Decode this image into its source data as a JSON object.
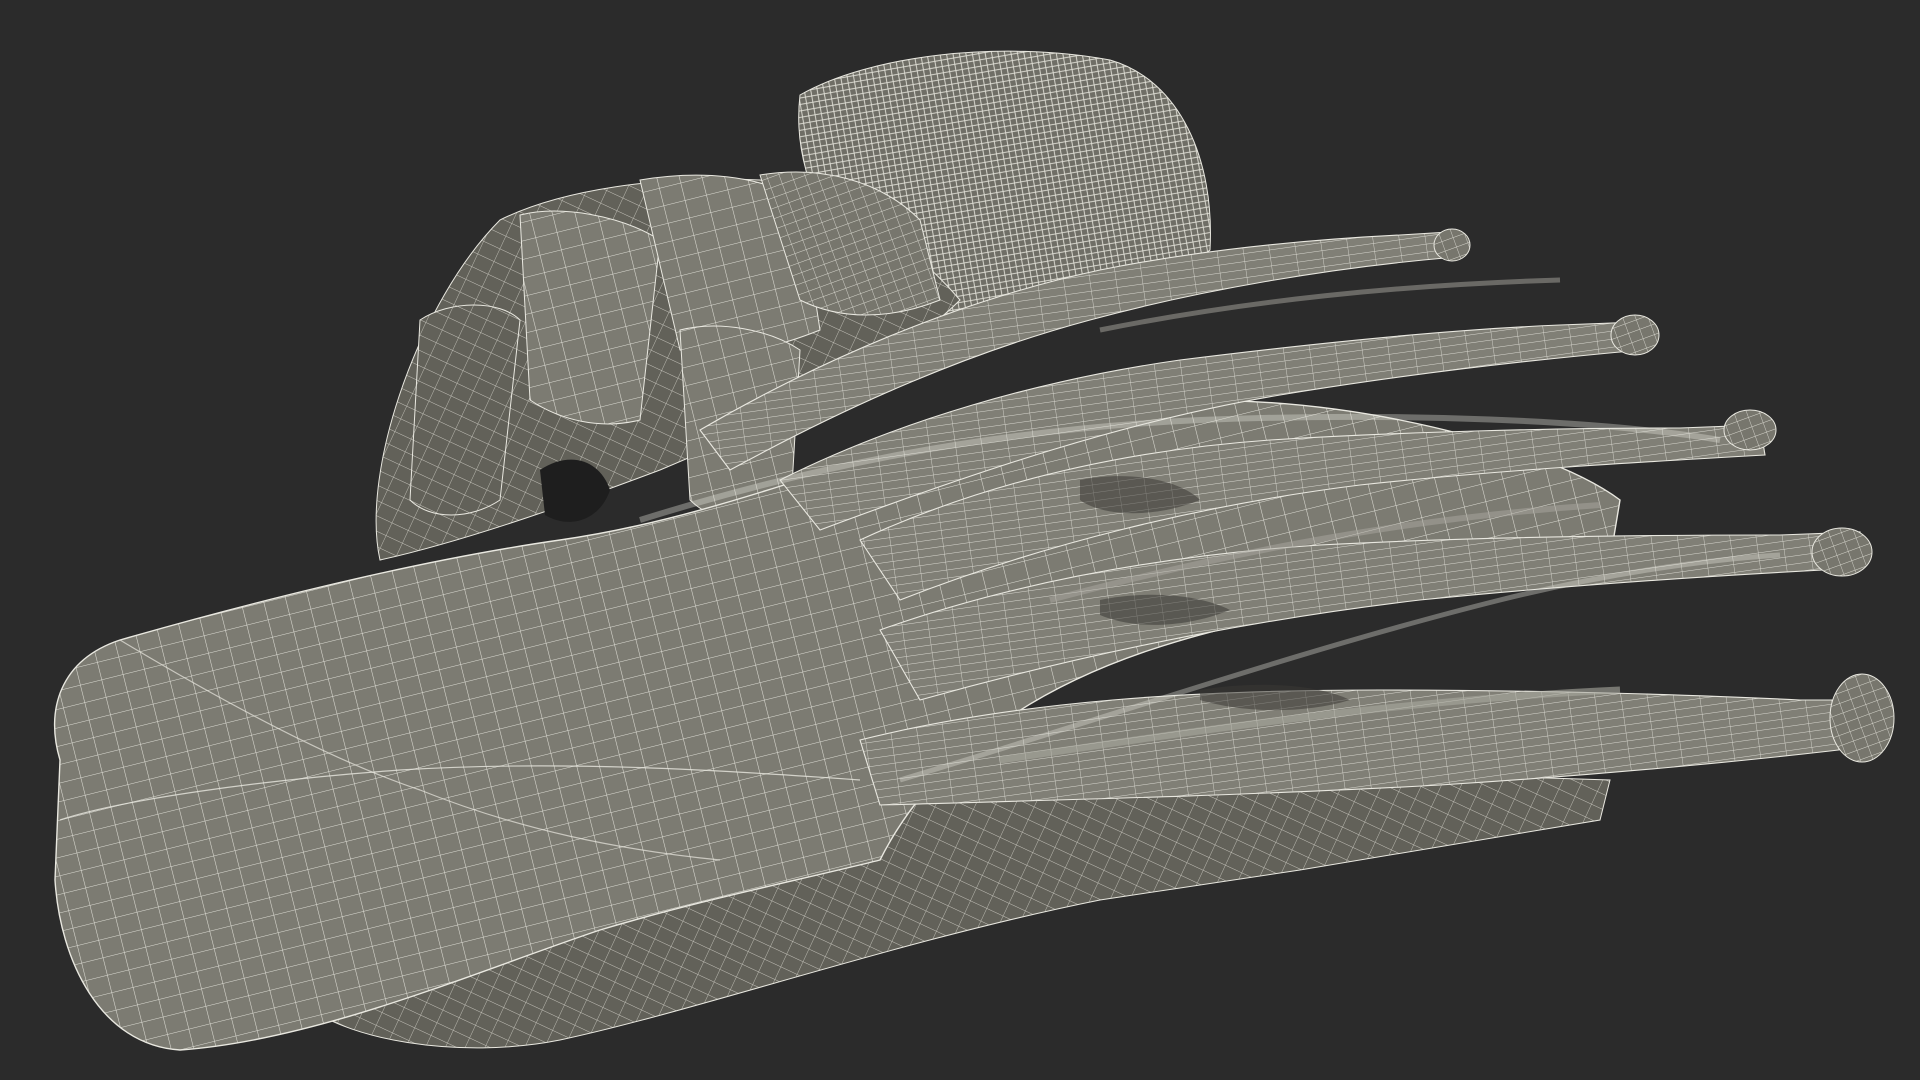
{
  "scene": {
    "background_color": "#2b2b2b",
    "mesh_fill_color": "#7c7b72",
    "mesh_shade_color": "#5f5e57",
    "mesh_highlight_color": "#8c8b82",
    "wire_color": "#e9e8e0",
    "subject": "foot-muscle-wireframe-model",
    "toe_count": 5
  }
}
